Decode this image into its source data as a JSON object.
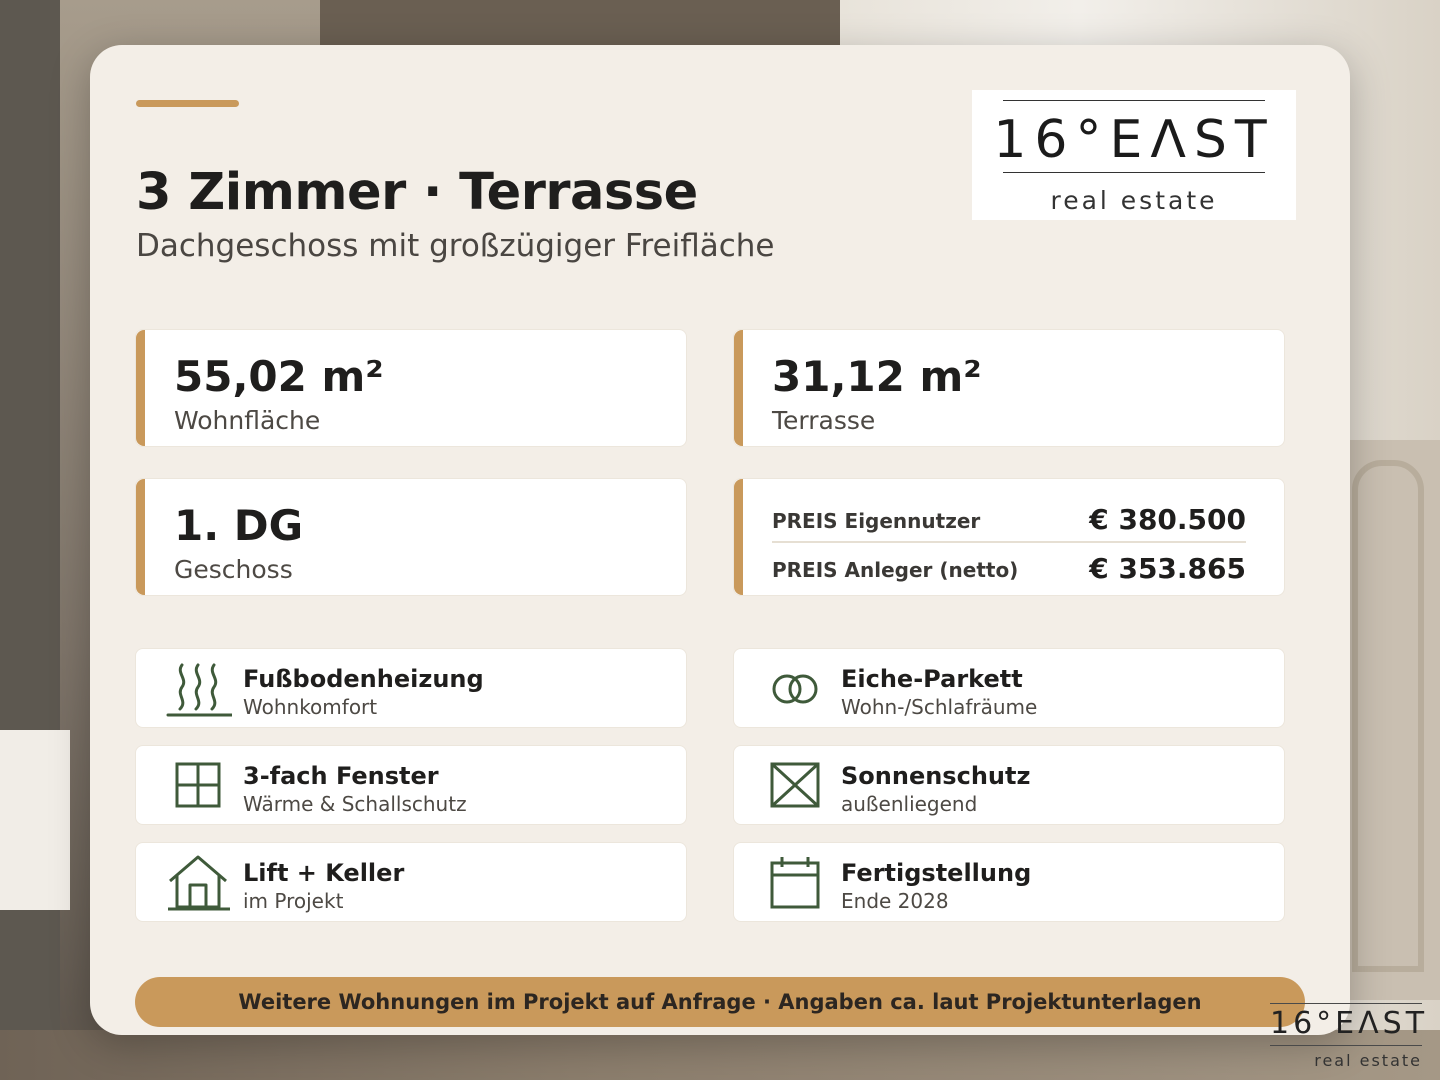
{
  "header": {
    "title": "3 Zimmer · Terrasse",
    "subtitle": "Dachgeschoss mit großzügiger Freifläche"
  },
  "logo": {
    "name": "16°EΛST",
    "tagline": "real estate"
  },
  "stats": {
    "living_area": {
      "value": "55,02 m²",
      "label": "Wohnfläche"
    },
    "terrace": {
      "value": "31,12 m²",
      "label": "Terrasse"
    },
    "floor": {
      "value": "1. DG",
      "label": "Geschoss"
    }
  },
  "prices": {
    "owner": {
      "label": "PREIS Eigennutzer",
      "value": "€ 380.500"
    },
    "investor": {
      "label": "PREIS Anleger (netto)",
      "value": "€ 353.865"
    }
  },
  "features": [
    {
      "title": "Fußbodenheizung",
      "subtitle": "Wohnkomfort",
      "icon": "floor-heating-icon"
    },
    {
      "title": "Eiche-Parkett",
      "subtitle": "Wohn-/Schlafräume",
      "icon": "rings-icon"
    },
    {
      "title": "3-fach Fenster",
      "subtitle": "Wärme & Schallschutz",
      "icon": "window-icon"
    },
    {
      "title": "Sonnenschutz",
      "subtitle": "außenliegend",
      "icon": "sunshade-icon"
    },
    {
      "title": "Lift + Keller",
      "subtitle": "im Projekt",
      "icon": "house-icon"
    },
    {
      "title": "Fertigstellung",
      "subtitle": "Ende 2028",
      "icon": "calendar-icon"
    }
  ],
  "footer": {
    "note": "Weitere Wohnungen im Projekt auf Anfrage · Angaben ca. laut Projektunterlagen"
  },
  "colors": {
    "accent": "#c9995b",
    "icon": "#3f5a3a",
    "card": "#f3eee7"
  }
}
